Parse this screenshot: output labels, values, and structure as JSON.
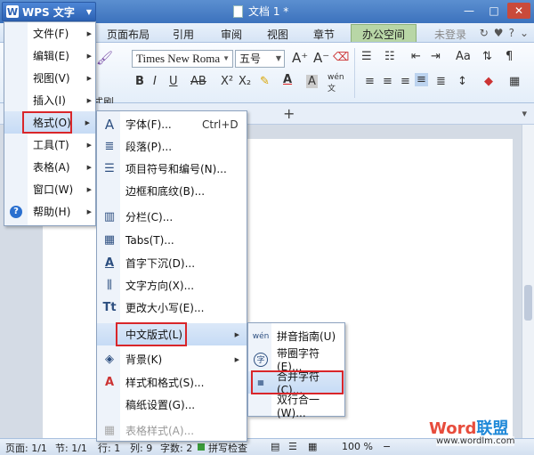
{
  "app": {
    "name": "WPS 文字",
    "doc_title": "文档 1 *"
  },
  "tabs": [
    "页面布局",
    "引用",
    "审阅",
    "视图",
    "章节"
  ],
  "active_tab": "办公空间",
  "login": "未登录",
  "ribbon": {
    "font_name": "Times New Roma",
    "font_size": "五号",
    "format_painter": "式刷"
  },
  "main_menu": [
    {
      "label": "文件(F)"
    },
    {
      "label": "编辑(E)"
    },
    {
      "label": "视图(V)"
    },
    {
      "label": "插入(I)"
    },
    {
      "label": "格式(O)"
    },
    {
      "label": "工具(T)"
    },
    {
      "label": "表格(A)"
    },
    {
      "label": "窗口(W)"
    },
    {
      "label": "帮助(H)"
    }
  ],
  "format_menu": [
    {
      "label": "字体(F)...",
      "shortcut": "Ctrl+D",
      "icon": "font-icon"
    },
    {
      "label": "段落(P)...",
      "icon": "paragraph-icon"
    },
    {
      "label": "项目符号和编号(N)...",
      "icon": "bullets-icon"
    },
    {
      "label": "边框和底纹(B)...",
      "icon": ""
    },
    {
      "label": "分栏(C)...",
      "icon": "columns-icon"
    },
    {
      "label": "Tabs(T)...",
      "icon": "tabs-icon"
    },
    {
      "label": "首字下沉(D)...",
      "icon": "drop-cap-icon"
    },
    {
      "label": "文字方向(X)...",
      "icon": "text-direction-icon"
    },
    {
      "label": "更改大小写(E)...",
      "icon": "change-case-icon"
    },
    {
      "label": "中文版式(L)",
      "icon": ""
    },
    {
      "label": "背景(K)",
      "icon": "background-icon"
    },
    {
      "label": "样式和格式(S)...",
      "icon": "styles-icon"
    },
    {
      "label": "稿纸设置(G)...",
      "icon": ""
    },
    {
      "label": "表格样式(A)...",
      "icon": "table-style-icon"
    }
  ],
  "chinese_layout_menu": [
    {
      "label": "拼音指南(U)",
      "icon": "pinyin-icon"
    },
    {
      "label": "带圈字符(E)...",
      "icon": "enclosed-char-icon"
    },
    {
      "label": "合并字符(C)...",
      "icon": "combine-chars-icon"
    },
    {
      "label": "双行合一(W)...",
      "icon": ""
    }
  ],
  "status": {
    "page": "页面: 1/1",
    "section": "节: 1/1",
    "row": "行: 1",
    "col": "列: 9",
    "words": "字数: 2",
    "spell": "拼写检查",
    "zoom": "100 %"
  },
  "watermark": {
    "word": "Word",
    "brand": "联盟",
    "url": "www.wordlm.com"
  },
  "colors": {
    "title_bg": "#3c72bd",
    "active_tab_bg": "#b8d6a6",
    "highlight": "#d9262a",
    "hover": "#c6dbf5"
  }
}
